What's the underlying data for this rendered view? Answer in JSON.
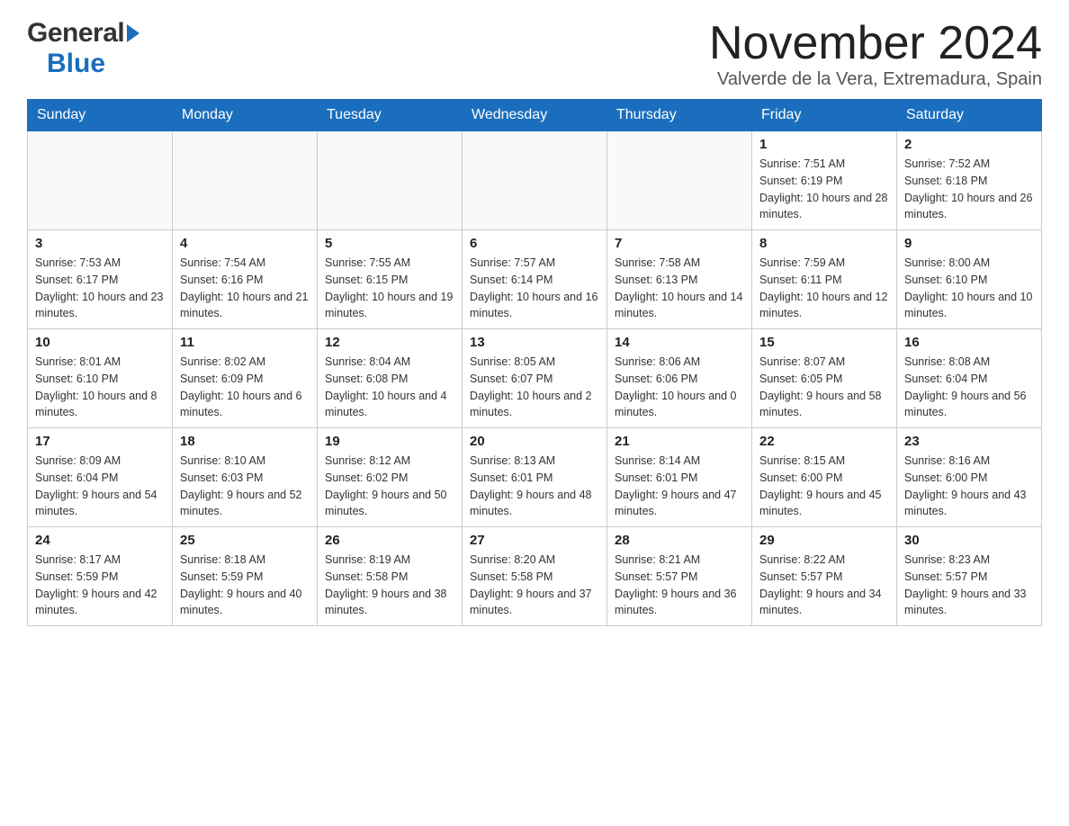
{
  "header": {
    "month_title": "November 2024",
    "location": "Valverde de la Vera, Extremadura, Spain",
    "logo_general": "General",
    "logo_blue": "Blue"
  },
  "days_of_week": [
    "Sunday",
    "Monday",
    "Tuesday",
    "Wednesday",
    "Thursday",
    "Friday",
    "Saturday"
  ],
  "weeks": [
    [
      {
        "day": "",
        "info": ""
      },
      {
        "day": "",
        "info": ""
      },
      {
        "day": "",
        "info": ""
      },
      {
        "day": "",
        "info": ""
      },
      {
        "day": "",
        "info": ""
      },
      {
        "day": "1",
        "info": "Sunrise: 7:51 AM\nSunset: 6:19 PM\nDaylight: 10 hours and 28 minutes."
      },
      {
        "day": "2",
        "info": "Sunrise: 7:52 AM\nSunset: 6:18 PM\nDaylight: 10 hours and 26 minutes."
      }
    ],
    [
      {
        "day": "3",
        "info": "Sunrise: 7:53 AM\nSunset: 6:17 PM\nDaylight: 10 hours and 23 minutes."
      },
      {
        "day": "4",
        "info": "Sunrise: 7:54 AM\nSunset: 6:16 PM\nDaylight: 10 hours and 21 minutes."
      },
      {
        "day": "5",
        "info": "Sunrise: 7:55 AM\nSunset: 6:15 PM\nDaylight: 10 hours and 19 minutes."
      },
      {
        "day": "6",
        "info": "Sunrise: 7:57 AM\nSunset: 6:14 PM\nDaylight: 10 hours and 16 minutes."
      },
      {
        "day": "7",
        "info": "Sunrise: 7:58 AM\nSunset: 6:13 PM\nDaylight: 10 hours and 14 minutes."
      },
      {
        "day": "8",
        "info": "Sunrise: 7:59 AM\nSunset: 6:11 PM\nDaylight: 10 hours and 12 minutes."
      },
      {
        "day": "9",
        "info": "Sunrise: 8:00 AM\nSunset: 6:10 PM\nDaylight: 10 hours and 10 minutes."
      }
    ],
    [
      {
        "day": "10",
        "info": "Sunrise: 8:01 AM\nSunset: 6:10 PM\nDaylight: 10 hours and 8 minutes."
      },
      {
        "day": "11",
        "info": "Sunrise: 8:02 AM\nSunset: 6:09 PM\nDaylight: 10 hours and 6 minutes."
      },
      {
        "day": "12",
        "info": "Sunrise: 8:04 AM\nSunset: 6:08 PM\nDaylight: 10 hours and 4 minutes."
      },
      {
        "day": "13",
        "info": "Sunrise: 8:05 AM\nSunset: 6:07 PM\nDaylight: 10 hours and 2 minutes."
      },
      {
        "day": "14",
        "info": "Sunrise: 8:06 AM\nSunset: 6:06 PM\nDaylight: 10 hours and 0 minutes."
      },
      {
        "day": "15",
        "info": "Sunrise: 8:07 AM\nSunset: 6:05 PM\nDaylight: 9 hours and 58 minutes."
      },
      {
        "day": "16",
        "info": "Sunrise: 8:08 AM\nSunset: 6:04 PM\nDaylight: 9 hours and 56 minutes."
      }
    ],
    [
      {
        "day": "17",
        "info": "Sunrise: 8:09 AM\nSunset: 6:04 PM\nDaylight: 9 hours and 54 minutes."
      },
      {
        "day": "18",
        "info": "Sunrise: 8:10 AM\nSunset: 6:03 PM\nDaylight: 9 hours and 52 minutes."
      },
      {
        "day": "19",
        "info": "Sunrise: 8:12 AM\nSunset: 6:02 PM\nDaylight: 9 hours and 50 minutes."
      },
      {
        "day": "20",
        "info": "Sunrise: 8:13 AM\nSunset: 6:01 PM\nDaylight: 9 hours and 48 minutes."
      },
      {
        "day": "21",
        "info": "Sunrise: 8:14 AM\nSunset: 6:01 PM\nDaylight: 9 hours and 47 minutes."
      },
      {
        "day": "22",
        "info": "Sunrise: 8:15 AM\nSunset: 6:00 PM\nDaylight: 9 hours and 45 minutes."
      },
      {
        "day": "23",
        "info": "Sunrise: 8:16 AM\nSunset: 6:00 PM\nDaylight: 9 hours and 43 minutes."
      }
    ],
    [
      {
        "day": "24",
        "info": "Sunrise: 8:17 AM\nSunset: 5:59 PM\nDaylight: 9 hours and 42 minutes."
      },
      {
        "day": "25",
        "info": "Sunrise: 8:18 AM\nSunset: 5:59 PM\nDaylight: 9 hours and 40 minutes."
      },
      {
        "day": "26",
        "info": "Sunrise: 8:19 AM\nSunset: 5:58 PM\nDaylight: 9 hours and 38 minutes."
      },
      {
        "day": "27",
        "info": "Sunrise: 8:20 AM\nSunset: 5:58 PM\nDaylight: 9 hours and 37 minutes."
      },
      {
        "day": "28",
        "info": "Sunrise: 8:21 AM\nSunset: 5:57 PM\nDaylight: 9 hours and 36 minutes."
      },
      {
        "day": "29",
        "info": "Sunrise: 8:22 AM\nSunset: 5:57 PM\nDaylight: 9 hours and 34 minutes."
      },
      {
        "day": "30",
        "info": "Sunrise: 8:23 AM\nSunset: 5:57 PM\nDaylight: 9 hours and 33 minutes."
      }
    ]
  ]
}
